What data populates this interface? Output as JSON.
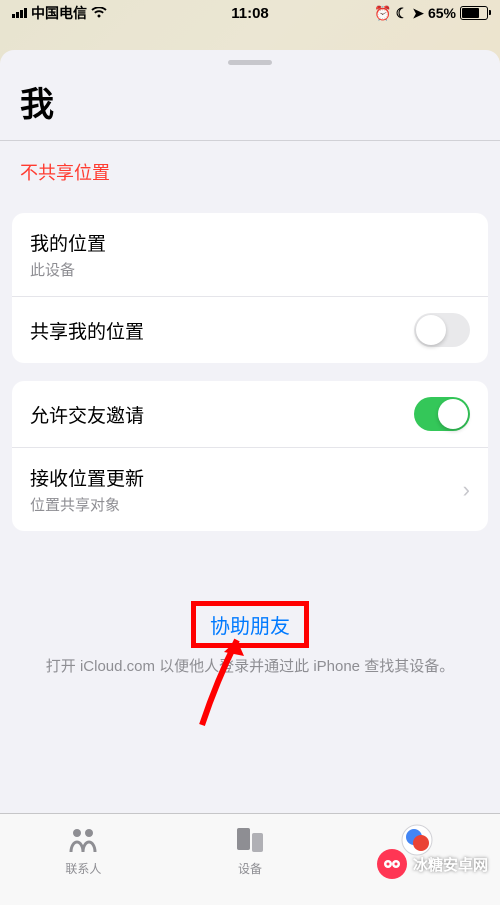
{
  "status": {
    "carrier": "中国电信",
    "time": "11:08",
    "battery_pct": "65%"
  },
  "title": "我",
  "not_sharing": "不共享位置",
  "card1": {
    "row1_label": "我的位置",
    "row1_sub": "此设备",
    "row2_label": "共享我的位置"
  },
  "card2": {
    "row1_label": "允许交友邀请",
    "row2_label": "接收位置更新",
    "row2_sub": "位置共享对象"
  },
  "help": {
    "link": "协助朋友",
    "desc": "打开 iCloud.com 以便他人登录并通过此 iPhone 查找其设备。"
  },
  "tabs": {
    "people": "联系人",
    "devices": "设备"
  },
  "watermark": "冰糖安卓网"
}
